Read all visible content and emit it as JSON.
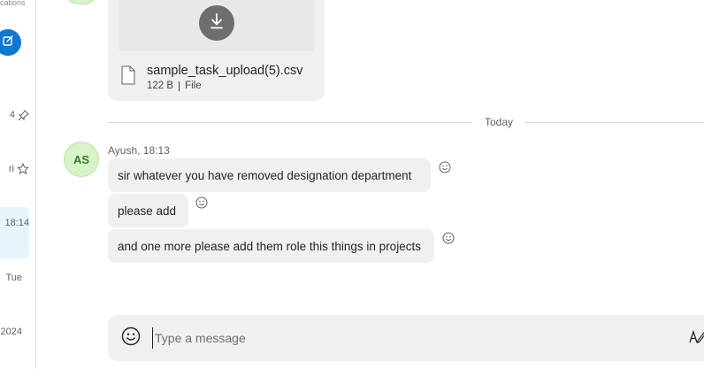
{
  "sidebar": {
    "notifications_label": "cations",
    "rows": [
      {
        "text": "4",
        "icon": "pin-icon"
      },
      {
        "text": "ri",
        "icon": "star-icon"
      },
      {
        "text": "18:14",
        "icon": ""
      },
      {
        "text": "Tue",
        "icon": ""
      },
      {
        "text": "2024",
        "icon": ""
      }
    ]
  },
  "file": {
    "name": "sample_task_upload(5).csv",
    "size": "122 B",
    "type": "File"
  },
  "divider": {
    "label": "Today"
  },
  "message_group": {
    "avatar_initials": "AS",
    "sender_line": "Ayush, 18:13",
    "messages": [
      {
        "text": "sir whatever you have removed designation department"
      },
      {
        "text": "please add"
      },
      {
        "text": "and one more please add them role this things in projects"
      }
    ]
  },
  "composer": {
    "placeholder": "Type a message"
  },
  "colors": {
    "accent": "#0f78d4",
    "bubble": "#f0f0f0",
    "avatar_bg": "#d8f3c8",
    "avatar_text": "#2e7d32"
  }
}
